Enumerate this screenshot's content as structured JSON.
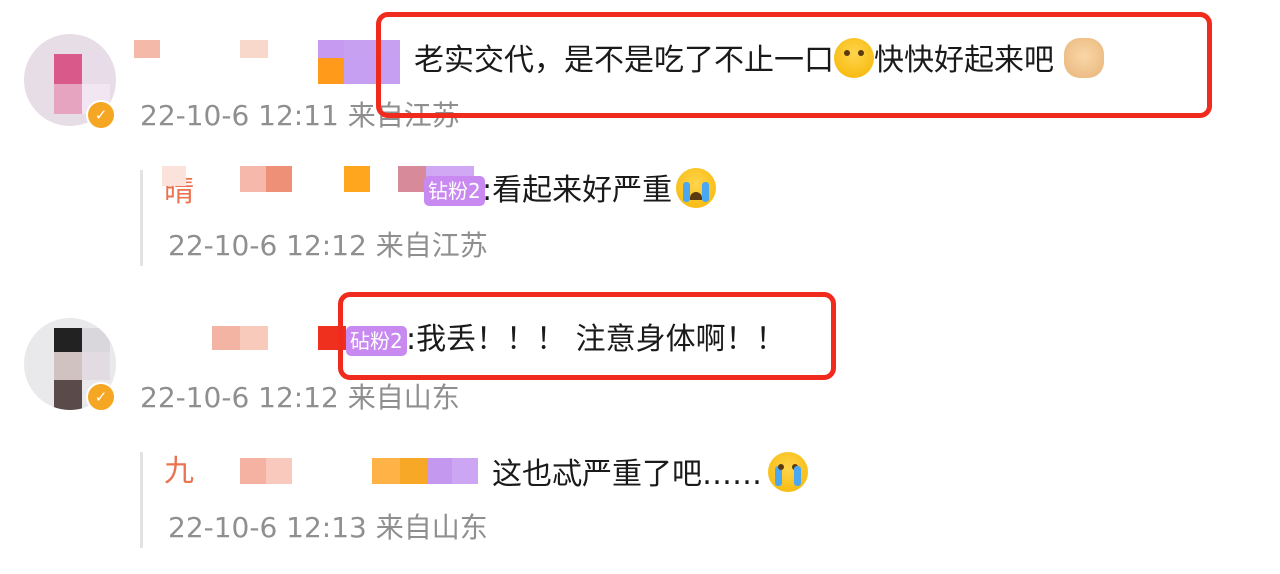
{
  "comments": [
    {
      "text_before_emoji": "老实交代，是不是吃了不止一口",
      "emoji1": "hand-over-eyes-emoji",
      "text_after_emoji": "快快好起来吧",
      "emoji2": "fist-emoji",
      "meta": "22-10-6 12:11 来自江苏",
      "reply": {
        "name_fragment": "晴",
        "fan_badge": "钻粉2",
        "text": ":看起来好严重",
        "emoji": "crying-face-emoji",
        "meta": "22-10-6 12:12 来自江苏"
      }
    },
    {
      "fan_badge": "砧粉2",
      "text": ":我丢！！！ 注意身体啊！！",
      "meta": "22-10-6 12:12 来自山东",
      "reply": {
        "name_fragment": "九",
        "text": "这也忒严重了吧……",
        "emoji": "crying-face-emoji",
        "meta": "22-10-6 12:13 来自山东"
      }
    }
  ],
  "colors": {
    "highlight_box": "#f02a1c",
    "meta_text": "#8f8f8f",
    "verified_badge": "#f5a623",
    "fan_badge": "#c88af0",
    "username": "#eb7350"
  }
}
